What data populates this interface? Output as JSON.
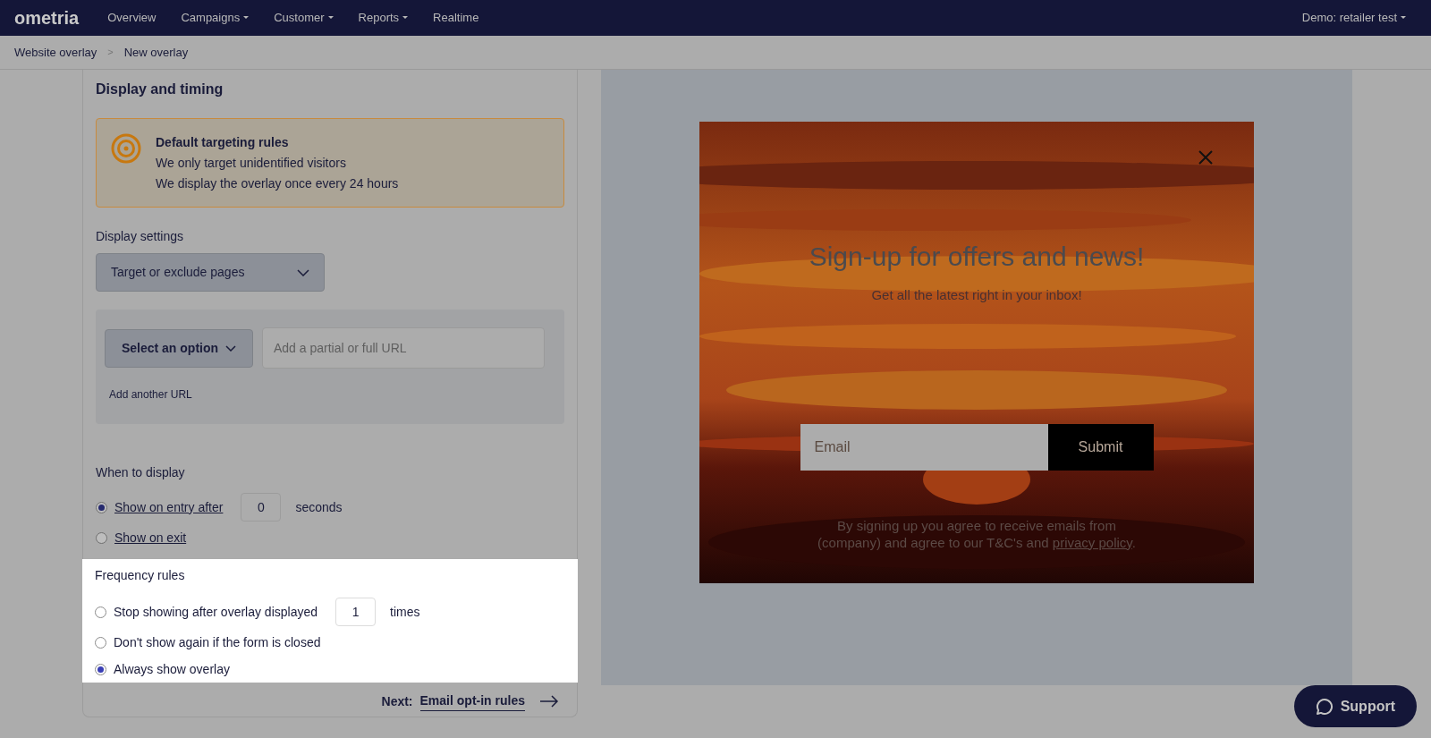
{
  "nav": {
    "logo": "ometria",
    "items": [
      {
        "label": "Overview",
        "dropdown": false
      },
      {
        "label": "Campaigns",
        "dropdown": true
      },
      {
        "label": "Customer",
        "dropdown": true
      },
      {
        "label": "Reports",
        "dropdown": true
      },
      {
        "label": "Realtime",
        "dropdown": false
      }
    ],
    "account": "Demo: retailer test"
  },
  "breadcrumb": {
    "items": [
      "Website overlay",
      "New overlay"
    ],
    "separator": ">"
  },
  "section_title": "Display and timing",
  "notice": {
    "title": "Default targeting rules",
    "lines": [
      "We only target unidentified visitors",
      "We display the overlay once every 24 hours"
    ]
  },
  "display_settings": {
    "label": "Display settings",
    "dropdown": "Target or exclude pages",
    "select": "Select an option",
    "url_placeholder": "Add a partial or full URL",
    "add_link": "Add another URL"
  },
  "when_to_display": {
    "label": "When to display",
    "options": [
      {
        "label": "Show on entry after",
        "selected": true,
        "value": "0",
        "suffix": "seconds"
      },
      {
        "label": "Show on exit",
        "selected": false
      }
    ]
  },
  "frequency_rules": {
    "label": "Frequency rules",
    "options": [
      {
        "label": "Stop showing after overlay displayed",
        "selected": false,
        "value": "1",
        "suffix": "times"
      },
      {
        "label": "Don't show again if the form is closed",
        "selected": false
      },
      {
        "label": "Always show overlay",
        "selected": true
      }
    ]
  },
  "next": {
    "prefix": "Next:",
    "link": "Email opt-in rules"
  },
  "preview": {
    "headline": "Sign-up for offers and news!",
    "subheadline": "Get all the latest right in your inbox!",
    "email_placeholder": "Email",
    "submit": "Submit",
    "disclaimer": "By signing up you agree to receive emails from (company) and agree to our T&C's and",
    "link": "privacy policy",
    "end": "."
  },
  "support": "Support"
}
